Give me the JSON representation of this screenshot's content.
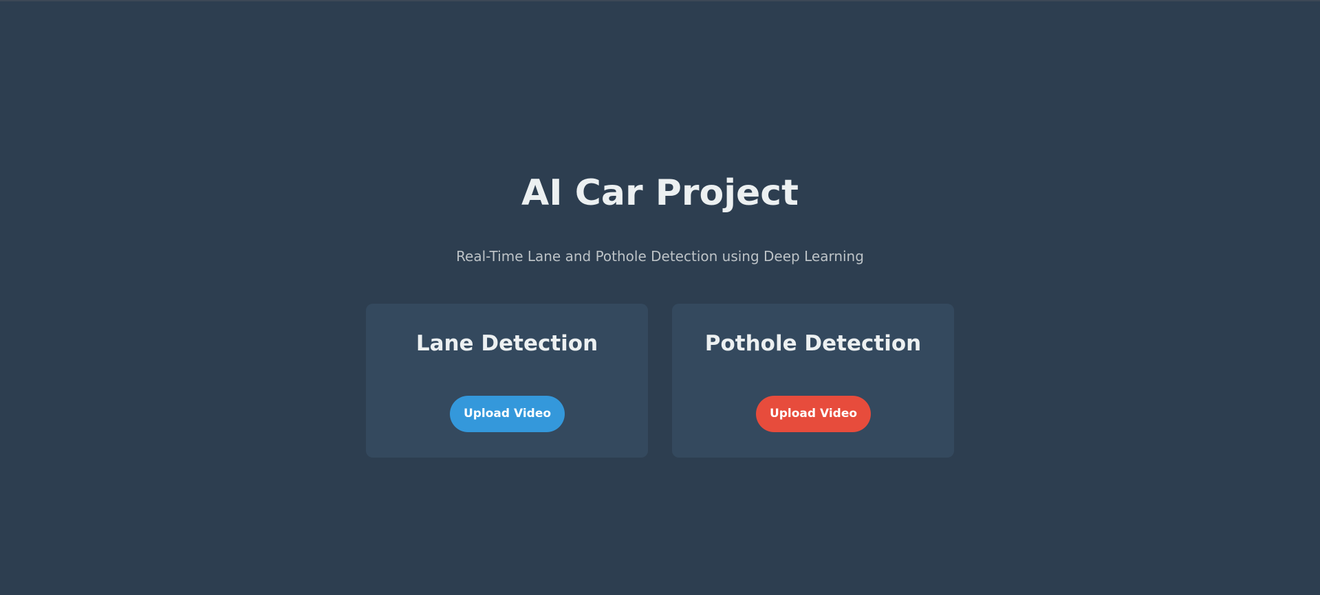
{
  "header": {
    "title": "AI Car Project",
    "subtitle": "Real-Time Lane and Pothole Detection using Deep Learning"
  },
  "cards": [
    {
      "title": "Lane Detection",
      "button_label": "Upload Video",
      "button_color": "#3498db"
    },
    {
      "title": "Pothole Detection",
      "button_label": "Upload Video",
      "button_color": "#e74c3c"
    }
  ],
  "colors": {
    "background": "#2d3e50",
    "card": "#34495e",
    "text": "#ecf0f1",
    "subtitle": "#bdc3c7"
  }
}
